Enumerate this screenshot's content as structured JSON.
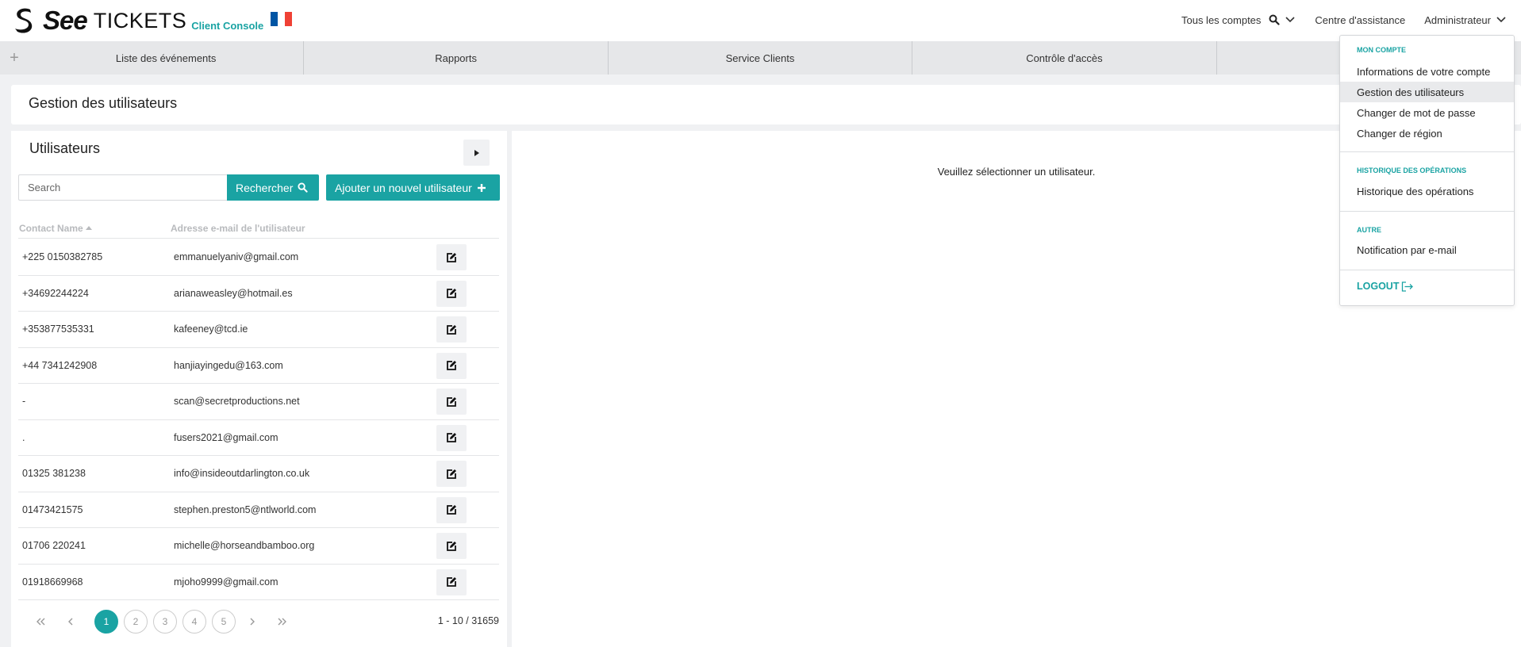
{
  "brand": {
    "see": "See",
    "tickets": "TICKETS",
    "console": "Client Console"
  },
  "header": {
    "accounts_label": "Tous les comptes",
    "help_label": "Centre d'assistance",
    "admin_label": "Administrateur"
  },
  "nav": {
    "tabs": [
      {
        "label": "Liste des événements"
      },
      {
        "label": "Rapports"
      },
      {
        "label": "Service Clients"
      },
      {
        "label": "Contrôle d'accès"
      },
      {
        "label": ""
      }
    ]
  },
  "page": {
    "title": "Gestion des utilisateurs"
  },
  "users_panel": {
    "title": "Utilisateurs",
    "search_placeholder": "Search",
    "search_button": "Rechercher",
    "add_button": "Ajouter un nouvel utilisateur",
    "col_contact": "Contact Name",
    "col_email": "Adresse e-mail de l'utilisateur",
    "rows": [
      {
        "contact": "+225 0150382785",
        "email": "emmanuelyaniv@gmail.com"
      },
      {
        "contact": "+34692244224",
        "email": "arianaweasley@hotmail.es"
      },
      {
        "contact": "+353877535331",
        "email": "kafeeney@tcd.ie"
      },
      {
        "contact": "+44 7341242908",
        "email": "hanjiayingedu@163.com"
      },
      {
        "contact": "-",
        "email": "scan@secretproductions.net"
      },
      {
        "contact": ".",
        "email": "fusers2021@gmail.com"
      },
      {
        "contact": "01325 381238",
        "email": "info@insideoutdarlington.co.uk"
      },
      {
        "contact": "01473421575",
        "email": "stephen.preston5@ntlworld.com"
      },
      {
        "contact": "01706 220241",
        "email": "michelle@horseandbamboo.org"
      },
      {
        "contact": "01918669968",
        "email": "mjoho9999@gmail.com"
      }
    ],
    "pagination": {
      "pages": [
        "1",
        "2",
        "3",
        "4",
        "5"
      ],
      "current": "1",
      "range_text": "1 - 10 / 31659"
    }
  },
  "detail_panel": {
    "empty_message": "Veuillez sélectionner un utilisateur."
  },
  "account_menu": {
    "section_account": "MON COMPTE",
    "item_info": "Informations de votre compte",
    "item_users": "Gestion des utilisateurs",
    "item_password": "Changer de mot de passe",
    "item_region": "Changer de région",
    "section_history": "HISTORIQUE DES OPÉRATIONS",
    "item_history": "Historique des opérations",
    "section_other": "AUTRE",
    "item_notification": "Notification par e-mail",
    "logout": "LOGOUT"
  },
  "colors": {
    "accent": "#1aa3a3",
    "flag_blue": "#0055a4",
    "flag_white": "#ffffff",
    "flag_red": "#ef4135"
  }
}
